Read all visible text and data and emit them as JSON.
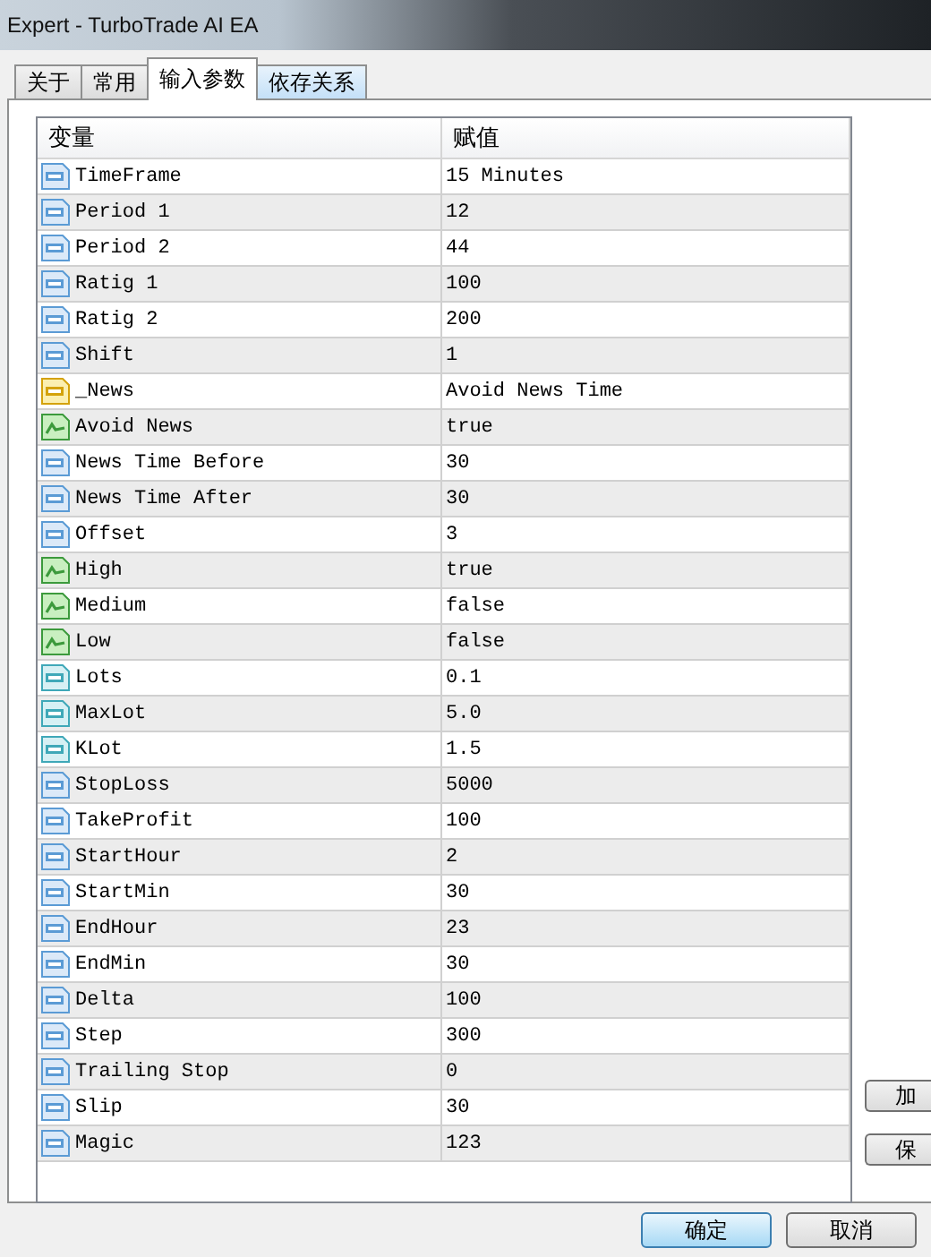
{
  "window": {
    "title": "Expert - TurboTrade AI EA"
  },
  "tabs": [
    {
      "label": "关于",
      "selected": false,
      "hovered": false
    },
    {
      "label": "常用",
      "selected": false,
      "hovered": false
    },
    {
      "label": "输入参数",
      "selected": true,
      "hovered": false
    },
    {
      "label": "依存关系",
      "selected": false,
      "hovered": true
    }
  ],
  "table": {
    "columns": [
      "变量",
      "赋值"
    ],
    "rows": [
      {
        "kind": "int",
        "name": "TimeFrame",
        "value": "15 Minutes"
      },
      {
        "kind": "int",
        "name": "Period 1",
        "value": "12"
      },
      {
        "kind": "int",
        "name": "Period 2",
        "value": "44"
      },
      {
        "kind": "int",
        "name": "Ratig 1",
        "value": "100"
      },
      {
        "kind": "int",
        "name": "Ratig 2",
        "value": "200"
      },
      {
        "kind": "int",
        "name": "Shift",
        "value": "1"
      },
      {
        "kind": "string",
        "name": "_News",
        "value": "Avoid News Time"
      },
      {
        "kind": "bool",
        "name": "Avoid News",
        "value": "true"
      },
      {
        "kind": "int",
        "name": "News Time Before",
        "value": "30"
      },
      {
        "kind": "int",
        "name": "News Time After",
        "value": "30"
      },
      {
        "kind": "int",
        "name": "Offset",
        "value": "3"
      },
      {
        "kind": "bool",
        "name": "High",
        "value": "true"
      },
      {
        "kind": "bool",
        "name": "Medium",
        "value": "false"
      },
      {
        "kind": "bool",
        "name": "Low",
        "value": "false"
      },
      {
        "kind": "double",
        "name": "Lots",
        "value": "0.1"
      },
      {
        "kind": "double",
        "name": "MaxLot",
        "value": "5.0"
      },
      {
        "kind": "double",
        "name": "KLot",
        "value": "1.5"
      },
      {
        "kind": "int",
        "name": "StopLoss",
        "value": "5000"
      },
      {
        "kind": "int",
        "name": "TakeProfit",
        "value": "100"
      },
      {
        "kind": "int",
        "name": "StartHour",
        "value": "2"
      },
      {
        "kind": "int",
        "name": "StartMin",
        "value": "30"
      },
      {
        "kind": "int",
        "name": "EndHour",
        "value": "23"
      },
      {
        "kind": "int",
        "name": "EndMin",
        "value": "30"
      },
      {
        "kind": "int",
        "name": "Delta",
        "value": "100"
      },
      {
        "kind": "int",
        "name": "Step",
        "value": "300"
      },
      {
        "kind": "int",
        "name": "Trailing Stop",
        "value": "0"
      },
      {
        "kind": "int",
        "name": "Slip",
        "value": "30"
      },
      {
        "kind": "int",
        "name": "Magic",
        "value": "123"
      }
    ]
  },
  "side_buttons": [
    "加",
    "保"
  ],
  "buttons": [
    {
      "label": "确定",
      "default": true
    },
    {
      "label": "取消",
      "default": false
    }
  ]
}
